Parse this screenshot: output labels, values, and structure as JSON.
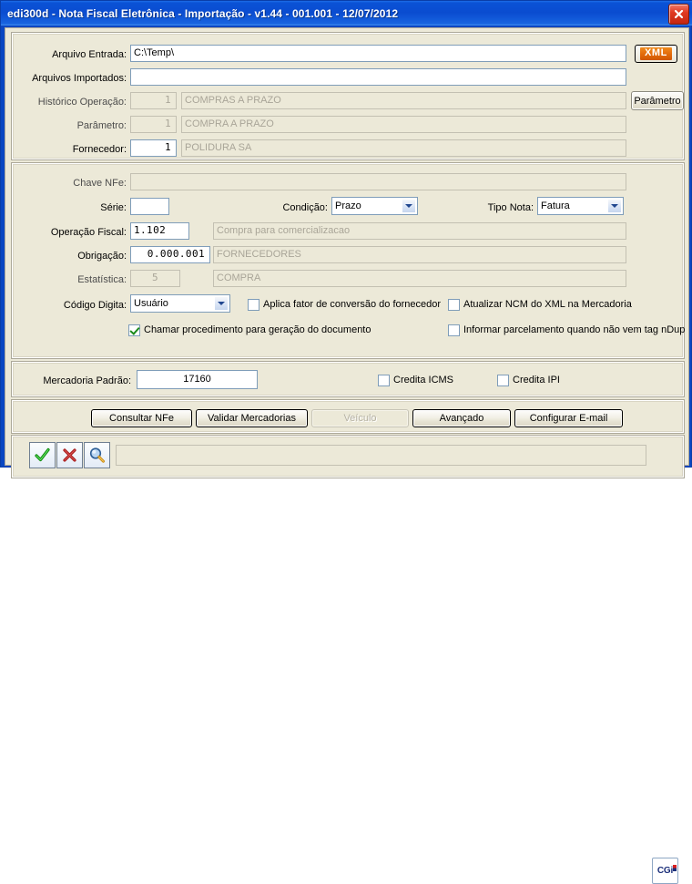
{
  "window": {
    "title": "edi300d - Nota Fiscal Eletrônica - Importação - v1.44 - 001.001 - 12/07/2012",
    "close_label": "close-icon"
  },
  "arquivo_panel": {
    "rows": [
      {
        "label": "Arquivo Entrada:",
        "value": "C:\\Temp\\"
      },
      {
        "label": "Arquivos Importados:",
        "value": ""
      },
      {
        "label": "Histórico Operação:",
        "code": "1",
        "desc": "COMPRAS A PRAZO"
      },
      {
        "label": "Parâmetro:",
        "code": "1",
        "desc": "COMPRA A PRAZO"
      },
      {
        "label": "Fornecedor:",
        "code": "1",
        "desc": "POLIDURA SA"
      }
    ],
    "xml_button": "XML",
    "parametro_button": "Parâmetro"
  },
  "nfe_panel": {
    "chave_label": "Chave NFe:",
    "chave_value": "",
    "serie_label": "Série:",
    "serie_value": "",
    "condicao_label": "Condição:",
    "condicao_value": "Prazo",
    "tipo_nota_label": "Tipo Nota:",
    "tipo_nota_value": "Fatura",
    "operacao_label": "Operação Fiscal:",
    "operacao_code": "1.102",
    "operacao_desc": "Compra para comercializacao",
    "obrigacao_label": "Obrigação:",
    "obrigacao_code": "0.000.001",
    "obrigacao_desc": "FORNECEDORES",
    "estatistica_label": "Estatística:",
    "estatistica_code": "5",
    "estatistica_desc": "COMPRA",
    "codigo_digita_label": "Código Digita:",
    "codigo_digita_value": "Usuário",
    "check_aplica_fator": "Aplica fator de conversão do fornecedor",
    "check_atualizar_ncm": "Atualizar NCM do XML na Mercadoria",
    "check_chamar_proc": "Chamar procedimento para geração do documento",
    "check_informar_parc": "Informar parcelamento quando não vem tag nDup"
  },
  "mercadoria_panel": {
    "label": "Mercadoria Padrão:",
    "value": "17160",
    "check_credita_icms": "Credita ICMS",
    "check_credita_ipi": "Credita IPI"
  },
  "action_buttons": [
    {
      "label": "Consultar NFe",
      "disabled": false
    },
    {
      "label": "Validar Mercadorias",
      "disabled": false
    },
    {
      "label": "Veículo",
      "disabled": true
    },
    {
      "label": "Avançado",
      "disabled": false
    },
    {
      "label": "Configurar E-mail",
      "disabled": false
    }
  ],
  "status_bar": {
    "confirm_icon": "check-icon",
    "cancel_icon": "cancel-icon",
    "search_icon": "magnifier-icon",
    "message": "",
    "logo_text": "CGi"
  },
  "colors": {
    "title_bar": "#0a4cd0",
    "face": "#ece9d8",
    "field_border": "#7f9db9",
    "xml_orange": "#e2690a",
    "accent_green": "#1a8a1a",
    "accent_red": "#b02020",
    "logo_blue": "#1b2f7a"
  }
}
